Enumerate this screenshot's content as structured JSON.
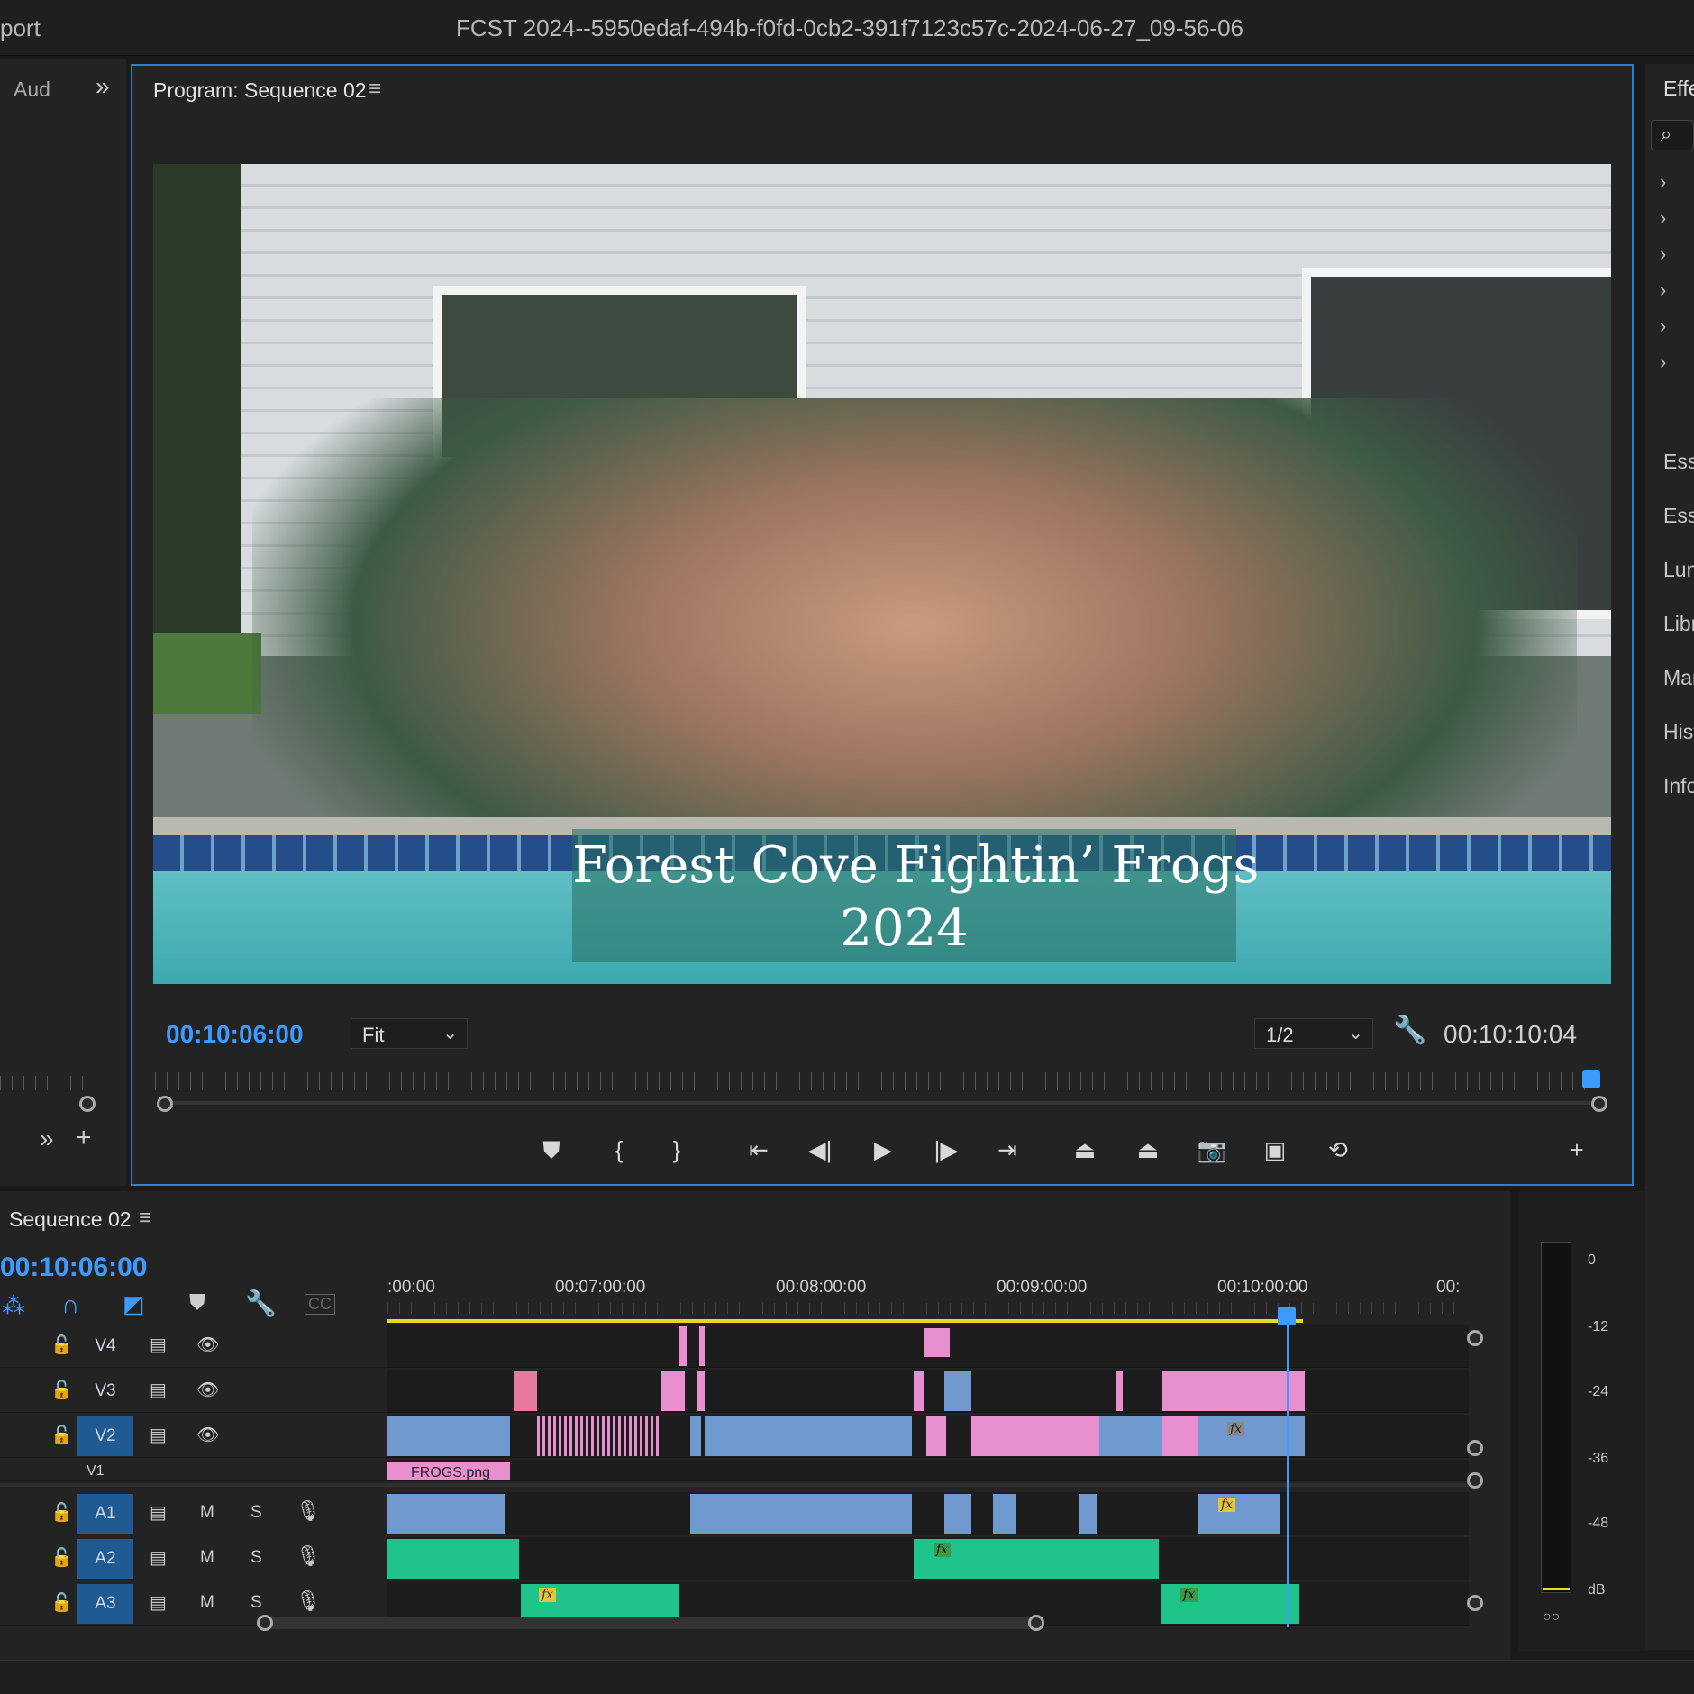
{
  "window": {
    "title_left": "port",
    "title": "FCST 2024--5950edaf-494b-f0fd-0cb2-391f7123c57c-2024-06-27_09-56-06"
  },
  "left_panel": {
    "tab": "Aud"
  },
  "program": {
    "title": "Program: Sequence 02",
    "video_title_line1": "Forest Cove Fightin’ Frogs",
    "video_title_line2": "2024",
    "current_timecode": "00:10:06:00",
    "zoom": "Fit",
    "resolution": "1/2",
    "duration": "00:10:10:04"
  },
  "right_panel": {
    "tab": "Effe",
    "items": [
      "Ess",
      "Ess",
      "Lun",
      "Libr",
      "Mar",
      "Hist",
      "Info"
    ]
  },
  "timeline": {
    "title": "Sequence 02",
    "timecode": "00:10:06:00",
    "ruler": [
      ":00:00",
      "00:07:00:00",
      "00:08:00:00",
      "00:09:00:00",
      "00:10:00:00",
      "00:"
    ],
    "video_tracks": [
      "V4",
      "V3",
      "V2"
    ],
    "partial_track": "V1",
    "audio_tracks": [
      "A1",
      "A2",
      "A3"
    ],
    "mute": "M",
    "solo": "S",
    "clip_name": "FROGS.png",
    "fx": "fx"
  },
  "meter": {
    "labels": [
      "0",
      "-12",
      "-24",
      "-36",
      "-48",
      "dB"
    ]
  }
}
